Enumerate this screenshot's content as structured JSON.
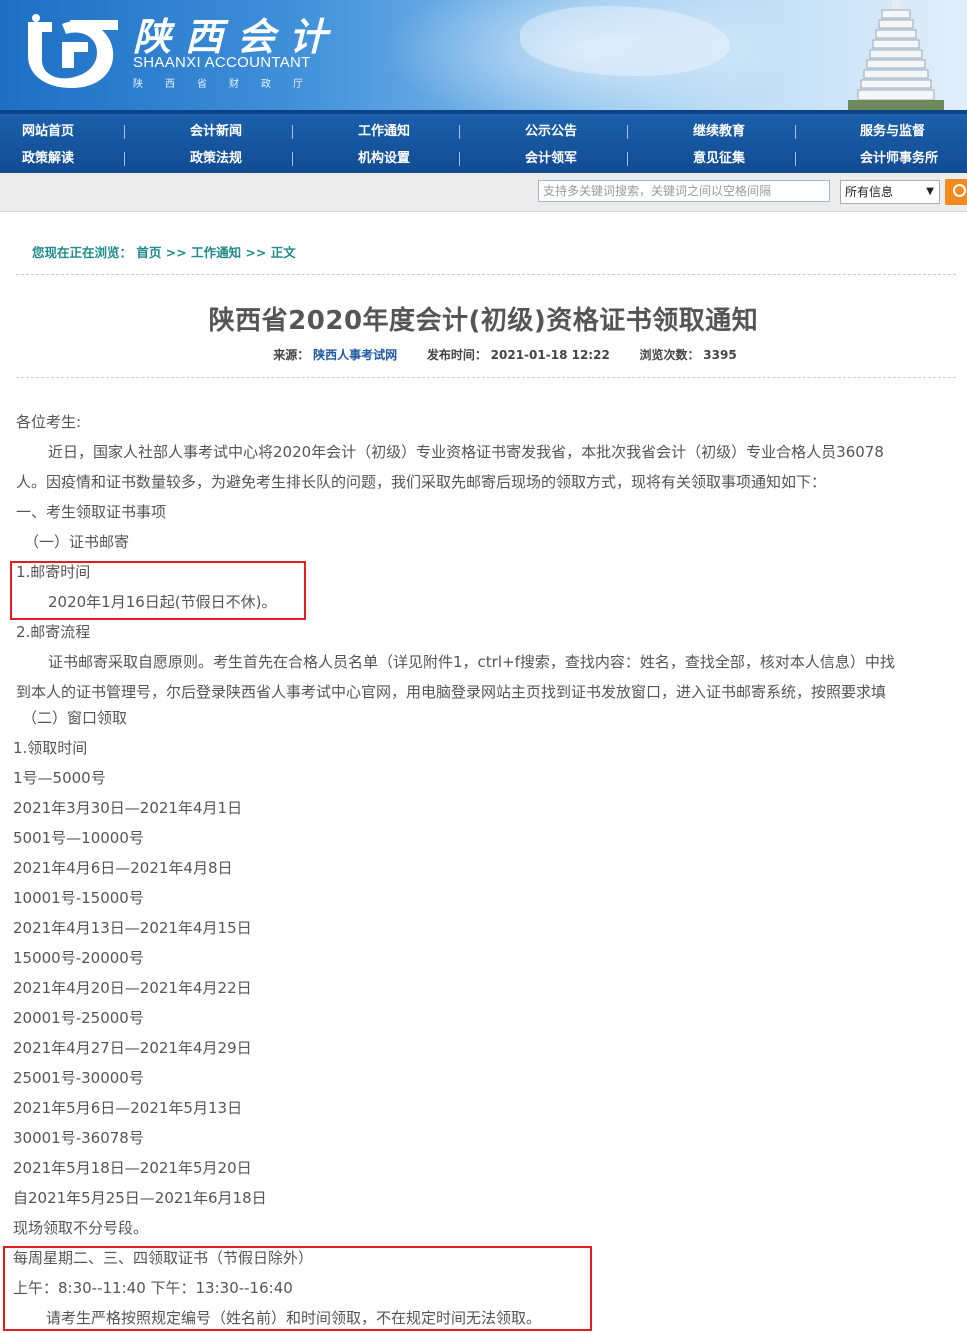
{
  "header": {
    "brand_cn": "陕西会计",
    "brand_en": "SHAANXI ACCOUNTANT",
    "brand_sub": "陕西省财政厅"
  },
  "nav": {
    "row1": [
      "网站首页",
      "会计新闻",
      "工作通知",
      "公示公告",
      "继续教育",
      "服务与监督"
    ],
    "row2": [
      "政策解读",
      "政策法规",
      "机构设置",
      "会计领军",
      "意见征集",
      "会计师事务所"
    ]
  },
  "search": {
    "placeholder": "支持多关键词搜索，关键词之间以空格间隔",
    "scope": "所有信息"
  },
  "breadcrumb": {
    "prefix": "您现在正在浏览：",
    "home": "首页",
    "sep": ">>",
    "section": "工作通知",
    "current": "正文"
  },
  "article": {
    "title": "陕西省2020年度会计(初级)资格证书领取通知",
    "source_label": "来源：",
    "source": "陕西人事考试网",
    "date_label": "发布时间：",
    "date": "2021-01-18 12:22",
    "views_label": "浏览次数：",
    "views": "3395",
    "lines": [
      "各位考生:",
      "近日，国家人社部人事考试中心将2020年会计（初级）专业资格证书寄发我省，本批次我省会计（初级）专业合格人员36078",
      "人。因疫情和证书数量较多，为避免考生排长队的问题，我们采取先邮寄后现场的领取方式，现将有关领取事项通知如下：",
      "一、考生领取证书事项",
      "（一）证书邮寄",
      "1.邮寄时间",
      "2020年1月16日起(节假日不休)。",
      "2.邮寄流程",
      "证书邮寄采取自愿原则。考生首先在合格人员名单（详见附件1，ctrl+f搜索，查找内容：姓名，查找全部，核对本人信息）中找",
      "到本人的证书管理号，尔后登录陕西省人事考试中心官网，用电脑登录网站主页找到证书发放窗口，进入证书邮寄系统，按照要求填",
      "（二）窗口领取",
      "1.领取时间",
      "1号—5000号",
      "2021年3月30日—2021年4月1日",
      "5001号—10000号",
      "2021年4月6日—2021年4月8日",
      "10001号-15000号",
      "2021年4月13日—2021年4月15日",
      "15000号-20000号",
      "2021年4月20日—2021年4月22日",
      "20001号-25000号",
      "2021年4月27日—2021年4月29日",
      "25001号-30000号",
      "2021年5月6日—2021年5月13日",
      "30001号-36078号",
      "2021年5月18日—2021年5月20日",
      "自2021年5月25日—2021年6月18日",
      "现场领取不分号段。",
      "每周星期二、三、四领取证书（节假日除外）",
      "上午：8:30--11:40 下午：13:30--16:40",
      "请考生严格按照规定编号（姓名前）和时间领取，不在规定时间无法领取。"
    ]
  },
  "colors": {
    "nav_bg": "#114c92",
    "crumb": "#1f8a8a",
    "source_link": "#1f5aa5",
    "highlight_box": "#e02020",
    "search_button": "#f38a1d"
  }
}
